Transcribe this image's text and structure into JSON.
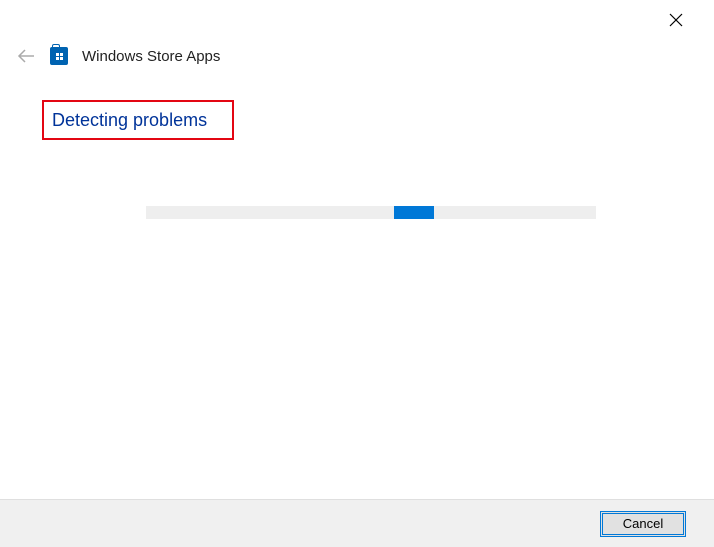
{
  "header": {
    "title": "Windows Store Apps"
  },
  "main": {
    "status": "Detecting problems"
  },
  "footer": {
    "cancel_label": "Cancel"
  }
}
